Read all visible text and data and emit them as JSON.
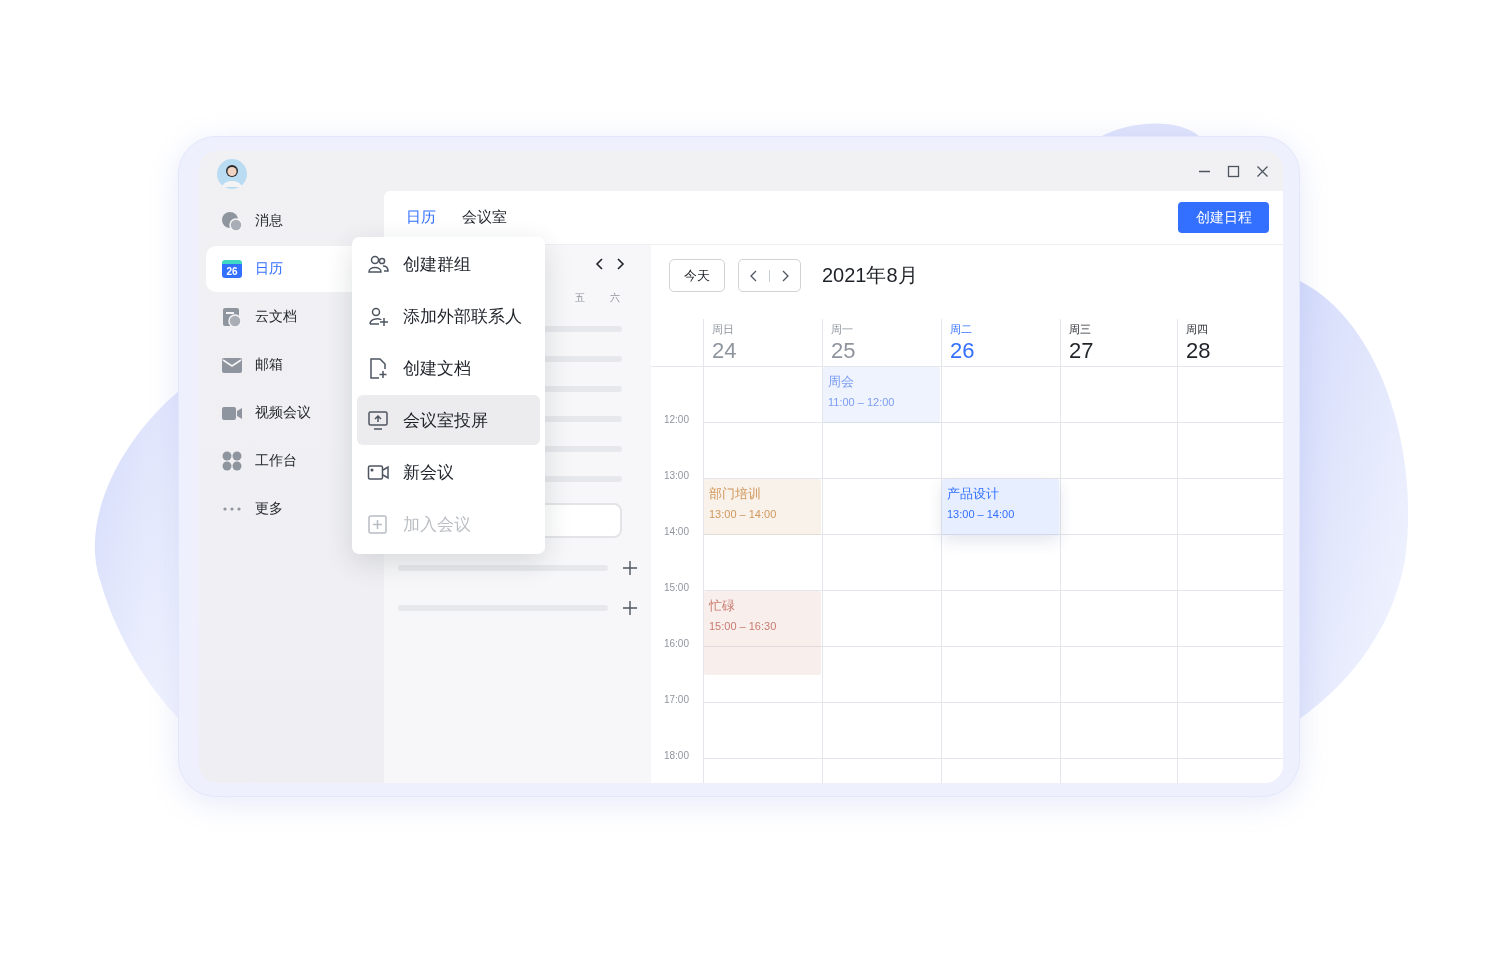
{
  "sidebar": {
    "items": [
      {
        "label": "消息",
        "selected": false
      },
      {
        "label": "日历",
        "selected": true,
        "icon_text": "26"
      },
      {
        "label": "云文档",
        "selected": false
      },
      {
        "label": "邮箱",
        "selected": false
      },
      {
        "label": "视频会议",
        "selected": false
      },
      {
        "label": "工作台",
        "selected": false
      },
      {
        "label": "更多",
        "selected": false
      }
    ]
  },
  "header": {
    "tabs": [
      {
        "label": "日历",
        "selected": true
      },
      {
        "label": "会议室",
        "selected": false
      }
    ],
    "create_button": "创建日程"
  },
  "mini_calendar": {
    "weekdays": [
      "五",
      "六"
    ]
  },
  "menu": {
    "items": [
      {
        "label": "创建群组",
        "selected": false,
        "disabled": false
      },
      {
        "label": "添加外部联系人",
        "selected": false,
        "disabled": false
      },
      {
        "label": "创建文档",
        "selected": false,
        "disabled": false
      },
      {
        "label": "会议室投屏",
        "selected": true,
        "disabled": false
      },
      {
        "label": "新会议",
        "selected": false,
        "disabled": false
      },
      {
        "label": "加入会议",
        "selected": false,
        "disabled": true
      }
    ]
  },
  "calendar": {
    "today_button": "今天",
    "title": "2021年8月",
    "times": [
      "12:00",
      "13:00",
      "14:00",
      "15:00",
      "16:00",
      "17:00",
      "18:00"
    ],
    "days": [
      {
        "weekday": "周日",
        "date": "24",
        "past": true,
        "today": false,
        "events": [
          {
            "title": "部门培训",
            "time": "13:00 – 14:00",
            "color": "#d0975c",
            "selected": false
          },
          {
            "title": "忙碌",
            "time": "15:00 – 16:30",
            "color": "#c97a6f",
            "selected": false
          }
        ]
      },
      {
        "weekday": "周一",
        "date": "25",
        "past": true,
        "today": false,
        "events": [
          {
            "title": "周会",
            "time": "11:00 – 12:00",
            "color": "#7c9df2",
            "selected": false
          }
        ]
      },
      {
        "weekday": "周二",
        "date": "26",
        "past": false,
        "today": true,
        "events": [
          {
            "title": "产品设计",
            "time": "13:00 – 14:00",
            "color": "#3370ff",
            "selected": true
          }
        ]
      },
      {
        "weekday": "周三",
        "date": "27",
        "past": false,
        "today": false
      },
      {
        "weekday": "周四",
        "date": "28",
        "past": false,
        "today": false
      }
    ]
  }
}
